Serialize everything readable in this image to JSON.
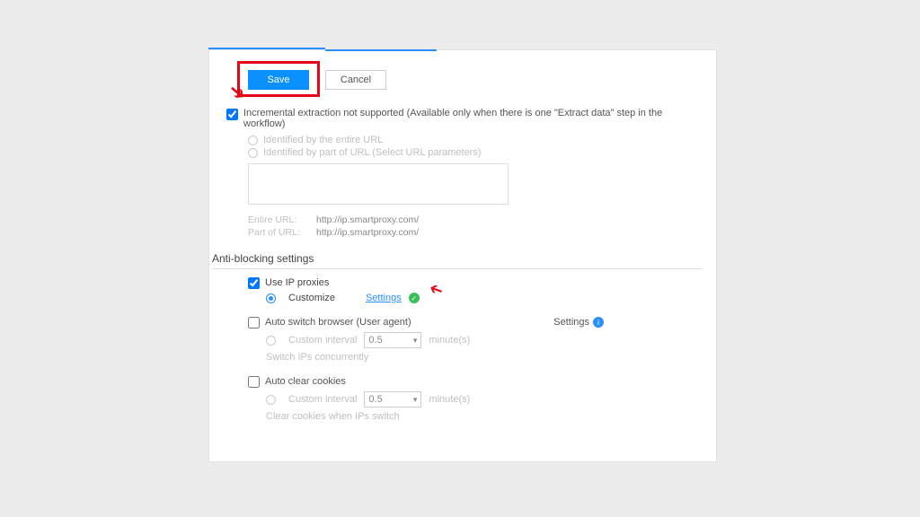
{
  "buttons": {
    "save": "Save",
    "cancel": "Cancel"
  },
  "incremental": {
    "label": "Incremental extraction not supported (Available only when there is one \"Extract data\" step in the workflow)",
    "option_entire": "Identified by the entire URL",
    "option_part": "Identified by part of URL (Select URL parameters)",
    "entire_url_label": "Entire URL:",
    "entire_url_value": "http://ip.smartproxy.com/",
    "part_url_label": "Part of URL:",
    "part_url_value": "http://ip.smartproxy.com/"
  },
  "anti": {
    "heading": "Anti-blocking settings",
    "use_ip": "Use IP proxies",
    "customize": "Customize",
    "settings_link": "Settings",
    "auto_switch": "Auto switch browser (User agent)",
    "settings_label": "Settings",
    "custom_interval": "Custom interval",
    "interval_value": "0.5",
    "minutes": "minute(s)",
    "switch_ips": "Switch IPs concurrently",
    "auto_clear": "Auto clear cookies",
    "clear_switch": "Clear cookies when IPs switch"
  }
}
